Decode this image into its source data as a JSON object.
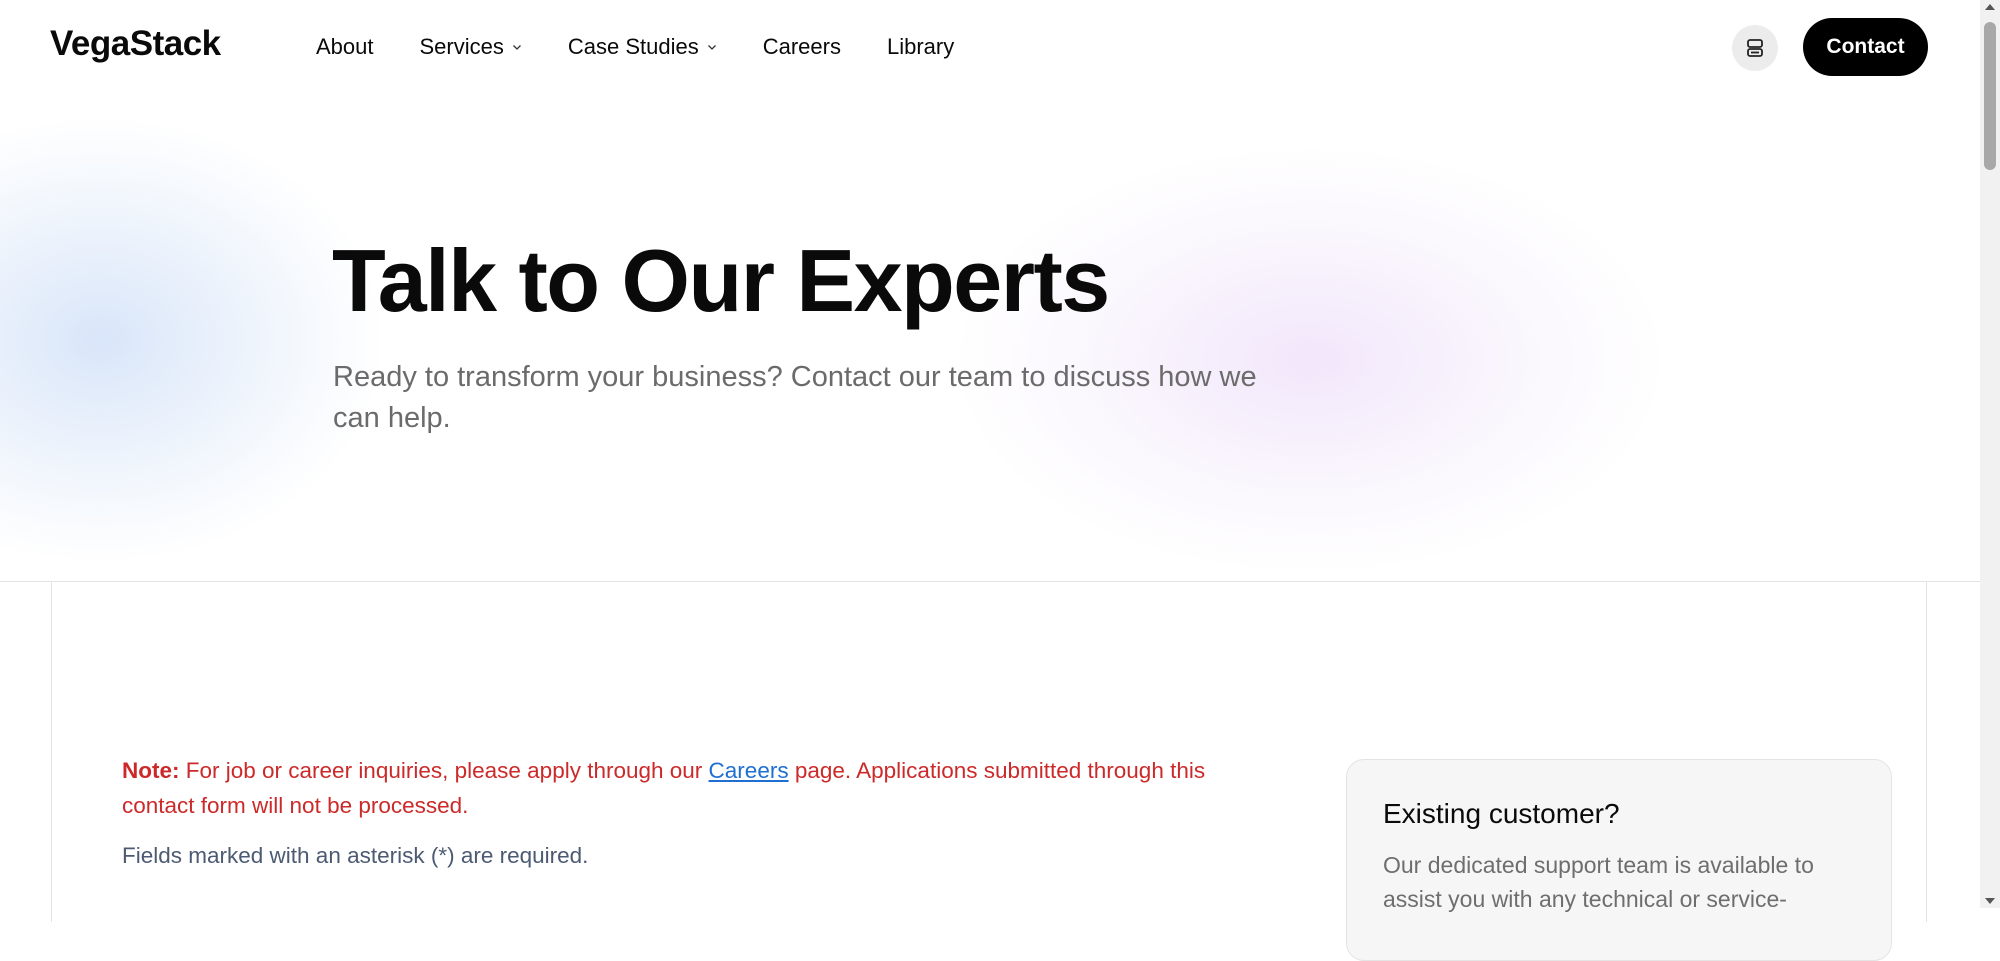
{
  "header": {
    "logo": "VegaStack",
    "nav": [
      {
        "label": "About",
        "has_dropdown": false
      },
      {
        "label": "Services",
        "has_dropdown": true
      },
      {
        "label": "Case Studies",
        "has_dropdown": true
      },
      {
        "label": "Careers",
        "has_dropdown": false
      },
      {
        "label": "Library",
        "has_dropdown": false
      }
    ],
    "theme_toggle_icon": "theme-toggle-icon",
    "contact_label": "Contact"
  },
  "hero": {
    "title": "Talk to Our Experts",
    "subtitle": "Ready to transform your business? Contact our team to discuss how we can help."
  },
  "form_notes": {
    "note_label": "Note:",
    "note_text_before": " For job or career inquiries, please apply through our ",
    "note_link": "Careers",
    "note_text_after": " page. Applications submitted through this contact form will not be processed.",
    "required": "Fields marked with an asterisk (*) are required."
  },
  "support_card": {
    "title": "Existing customer?",
    "text": "Our dedicated support team is available to assist you with any technical or service-"
  },
  "colors": {
    "note_red": "#cc2a2a",
    "link_blue": "#1f6fd1",
    "primary_button": "#000000"
  }
}
